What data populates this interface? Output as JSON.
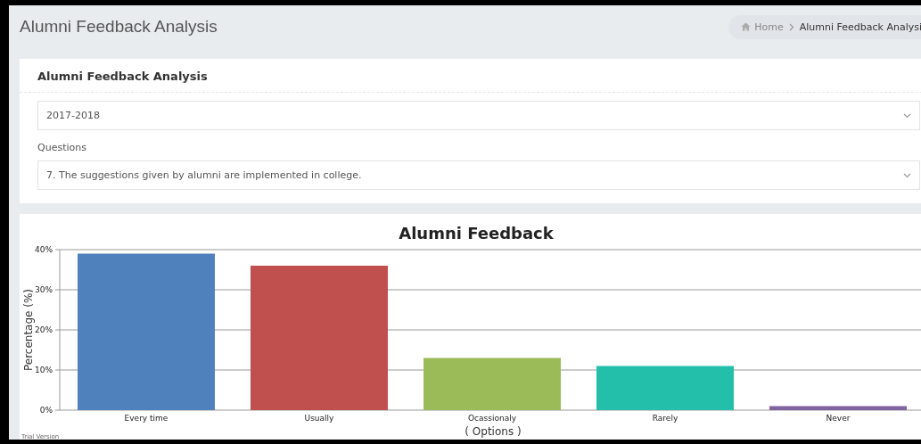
{
  "page": {
    "title": "Alumni Feedback Analysis"
  },
  "breadcrumb": [
    {
      "label": "Home",
      "kind": "home"
    },
    {
      "label": "Alumni Feedback Analysi",
      "kind": "current"
    }
  ],
  "filter_card": {
    "title": "Alumni Feedback Analysis",
    "year_select": {
      "value": "2017-2018"
    },
    "question_label": "Questions",
    "question_select": {
      "value": "7. The suggestions given by alumni are implemented in college."
    }
  },
  "chart_card": {
    "watermark_note": "Trial Version",
    "chart_data": {
      "type": "bar",
      "title": "Alumni Feedback",
      "xlabel": "( Options )",
      "ylabel": "Percentage (%)",
      "categories": [
        "Every time",
        "Usually",
        "Ocassionaly",
        "Rarely",
        "Never"
      ],
      "values": [
        39,
        36,
        13,
        11,
        1
      ],
      "ylim": [
        0,
        40
      ],
      "grid": true,
      "yticks": [
        {
          "value": 0,
          "label": "0%"
        },
        {
          "value": 10,
          "label": "10%"
        },
        {
          "value": 20,
          "label": "20%"
        },
        {
          "value": 30,
          "label": "30%"
        },
        {
          "value": 40,
          "label": "40%"
        }
      ]
    }
  }
}
